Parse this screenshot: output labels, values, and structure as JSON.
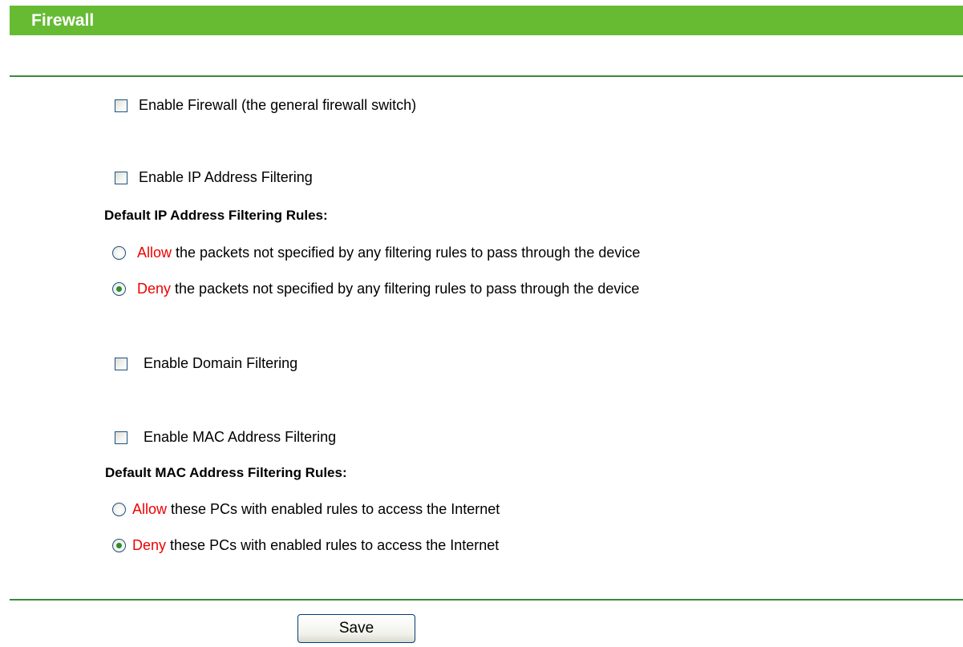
{
  "header": {
    "title": "Firewall"
  },
  "firewall": {
    "enable_label": "Enable Firewall (the general firewall switch)",
    "enabled": false
  },
  "ip_filtering": {
    "enable_label": "Enable IP Address Filtering",
    "enabled": false,
    "rules_heading": "Default IP Address Filtering Rules:",
    "options": [
      {
        "keyword": "Allow",
        "text": " the packets not specified by any filtering rules to pass through the device",
        "selected": false
      },
      {
        "keyword": "Deny",
        "text": " the packets not specified by any filtering rules to pass through the device",
        "selected": true
      }
    ]
  },
  "domain_filtering": {
    "enable_label": "Enable Domain Filtering",
    "enabled": false
  },
  "mac_filtering": {
    "enable_label": "Enable MAC Address Filtering",
    "enabled": false,
    "rules_heading": "Default MAC Address Filtering Rules:",
    "options": [
      {
        "keyword": "Allow",
        "text": " these PCs with enabled rules to access the Internet",
        "selected": false
      },
      {
        "keyword": "Deny",
        "text": " these PCs with enabled rules to access the Internet",
        "selected": true
      }
    ]
  },
  "actions": {
    "save_label": "Save"
  },
  "colors": {
    "header_bg": "#66bb33",
    "rule_line": "#3a8a3a",
    "keyword": "#ee0000",
    "control_border": "#1c5180",
    "radio_dot": "#2e8b2e"
  }
}
